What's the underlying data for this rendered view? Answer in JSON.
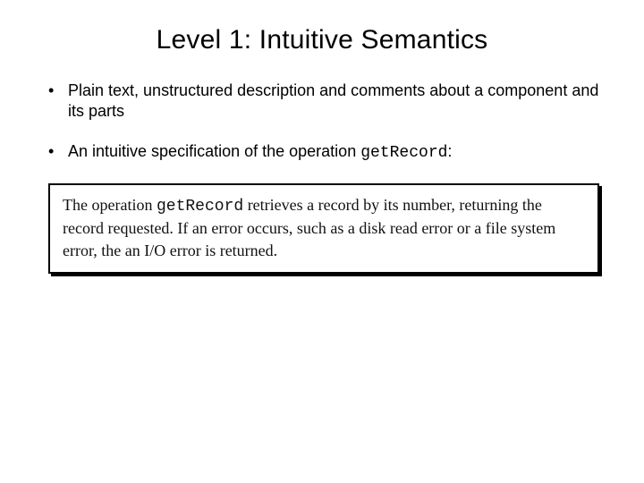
{
  "title": "Level 1: Intuitive Semantics",
  "bullet1": "Plain text, unstructured description and comments about a component and its parts",
  "bullet2_pre": "An intuitive specification of the operation ",
  "bullet2_code": "getRecord",
  "bullet2_post": ":",
  "spec_pre": "The operation ",
  "spec_code": "getRecord",
  "spec_post": " retrieves a record by its number, returning the record requested. If an error occurs, such as a disk read error or a file system error, the an I/O error is returned."
}
